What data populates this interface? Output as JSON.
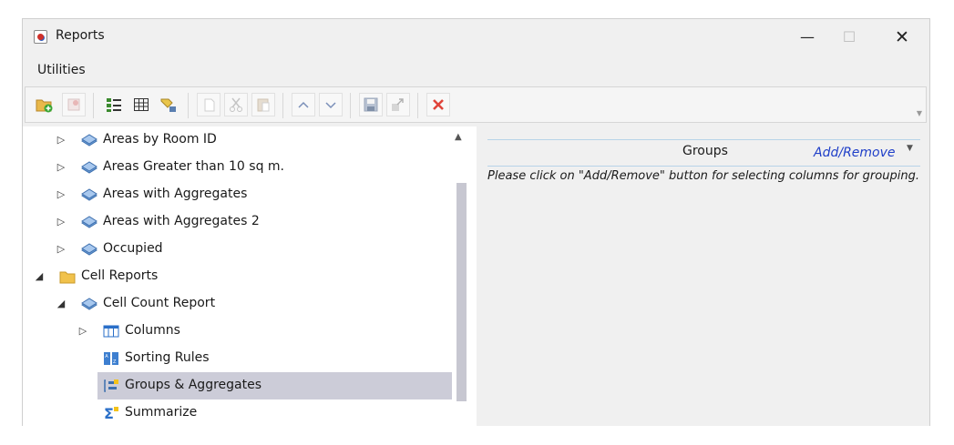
{
  "window": {
    "title": "Reports",
    "controls": {
      "minimize": "—",
      "maximize": "☐",
      "close": "✕"
    }
  },
  "menu": {
    "items": [
      "Utilities"
    ]
  },
  "toolbar": {
    "buttons": [
      {
        "name": "new-folder",
        "enabled": true
      },
      {
        "name": "new-report",
        "enabled": false
      },
      {
        "name": "list-view",
        "enabled": true
      },
      {
        "name": "table-view",
        "enabled": true
      },
      {
        "name": "tag",
        "enabled": true
      },
      {
        "name": "copy",
        "enabled": false
      },
      {
        "name": "cut",
        "enabled": false
      },
      {
        "name": "paste",
        "enabled": false
      },
      {
        "name": "move-up",
        "enabled": false
      },
      {
        "name": "move-down",
        "enabled": false
      },
      {
        "name": "save",
        "enabled": false
      },
      {
        "name": "export",
        "enabled": false
      },
      {
        "name": "delete",
        "enabled": true
      }
    ]
  },
  "tree": {
    "rows": [
      {
        "label": "Areas by Room ID",
        "expander": "▷",
        "icon": "report-icon",
        "level": 1
      },
      {
        "label": "Areas Greater than 10 sq m.",
        "expander": "▷",
        "icon": "report-icon",
        "level": 1
      },
      {
        "label": "Areas with Aggregates",
        "expander": "▷",
        "icon": "report-icon",
        "level": 1
      },
      {
        "label": "Areas with Aggregates 2",
        "expander": "▷",
        "icon": "report-icon",
        "level": 1
      },
      {
        "label": "Occupied",
        "expander": "▷",
        "icon": "report-icon",
        "level": 1
      },
      {
        "label": "Cell Reports",
        "expander": "◢",
        "icon": "folder-icon",
        "level": 0
      },
      {
        "label": "Cell Count Report",
        "expander": "◢",
        "icon": "report-icon",
        "level": 1
      },
      {
        "label": "Columns",
        "expander": "▷",
        "icon": "columns-icon",
        "level": 2
      },
      {
        "label": "Sorting Rules",
        "expander": "",
        "icon": "sorting-icon",
        "level": 2
      },
      {
        "label": "Groups & Aggregates",
        "expander": "",
        "icon": "groups-icon",
        "level": 2,
        "selected": true
      },
      {
        "label": "Summarize",
        "expander": "",
        "icon": "summarize-icon",
        "level": 2
      }
    ]
  },
  "groups_panel": {
    "header": "Groups",
    "add_remove": "Add/Remove",
    "dropdown": "▼",
    "hint": "Please click on \"Add/Remove\" button for selecting columns for grouping."
  }
}
